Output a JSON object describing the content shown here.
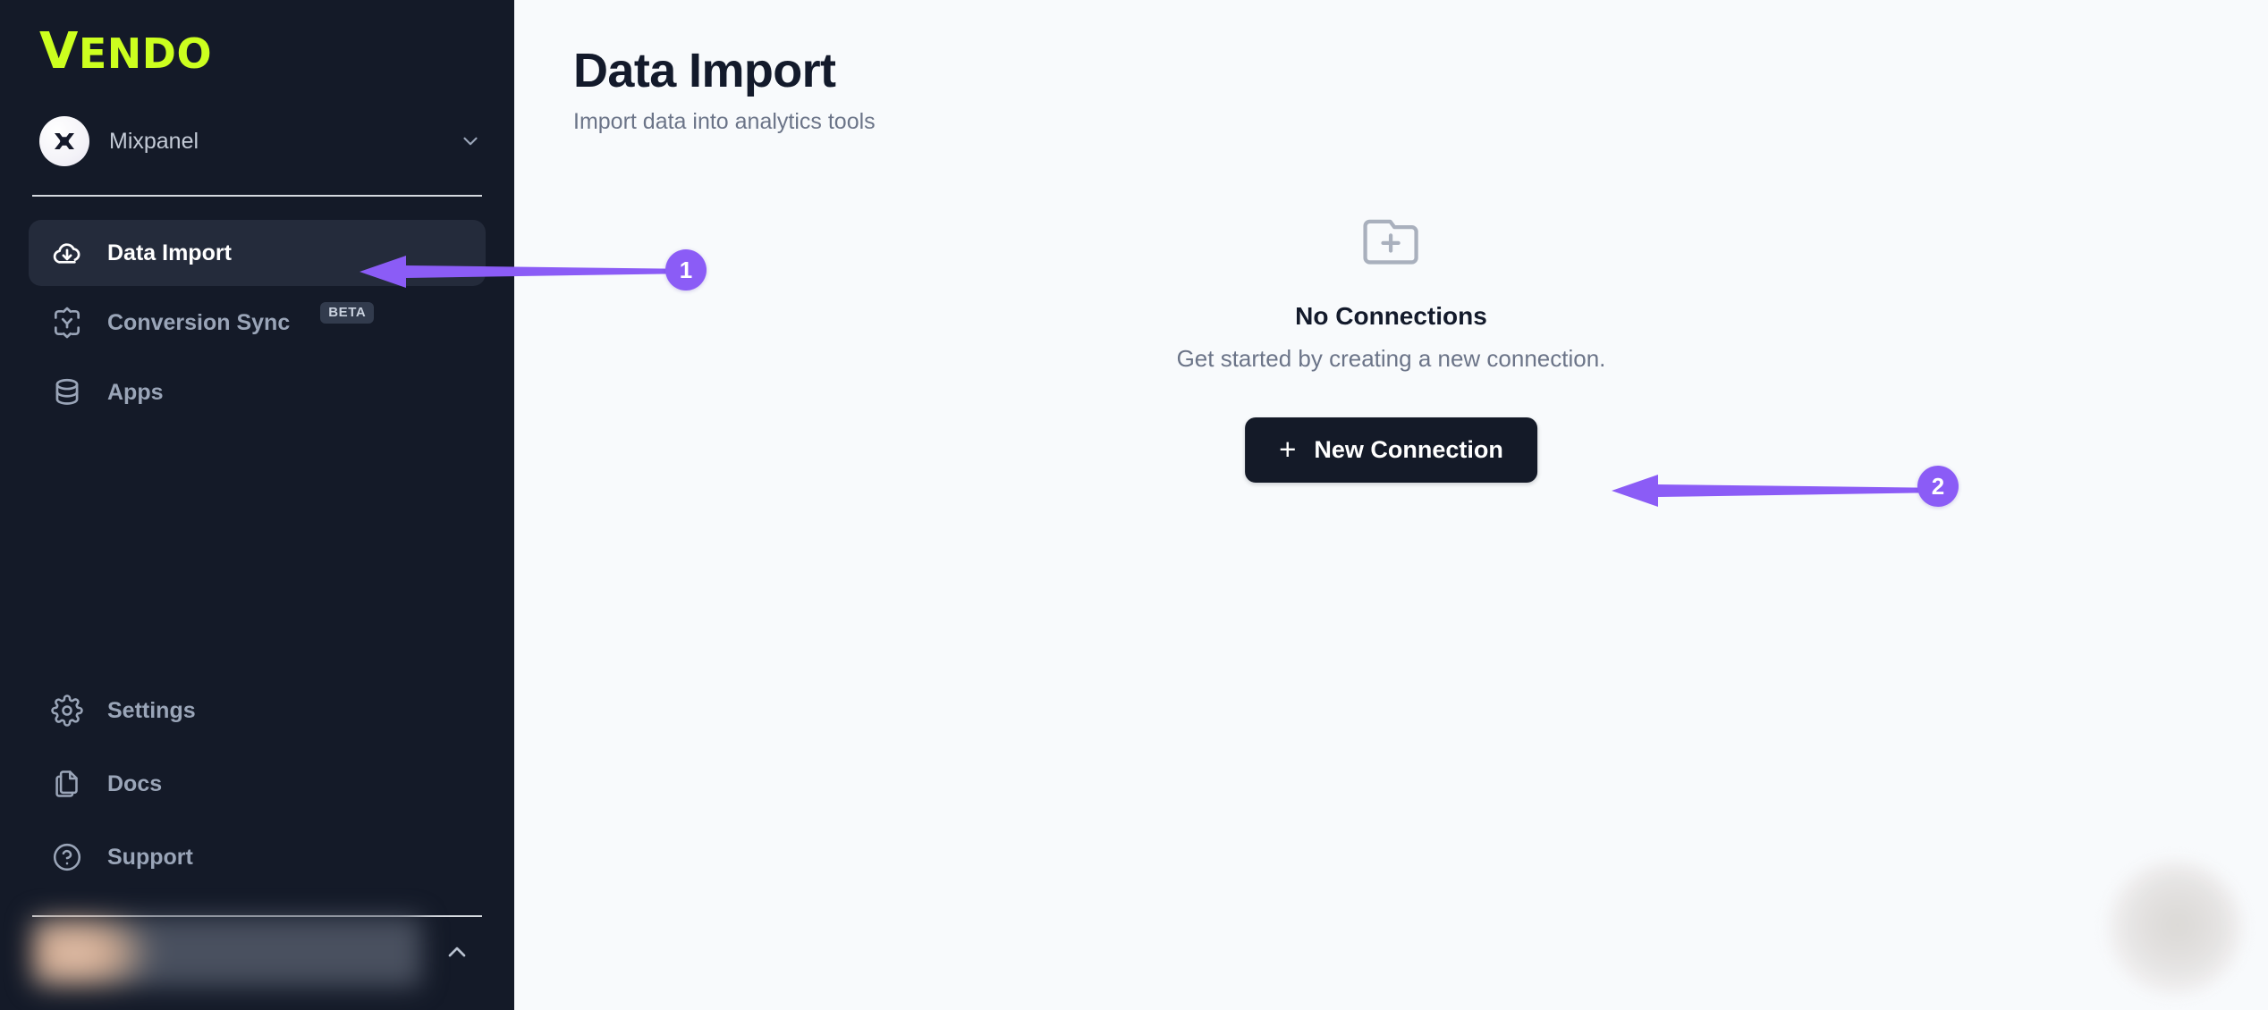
{
  "brand": {
    "logo_text": "VENDO",
    "logo_color": "#ccff1f"
  },
  "sidebar": {
    "workspace": {
      "name": "Mixpanel",
      "avatar_icon": "mixpanel-logo-icon",
      "chevron_icon": "chevron-down-icon"
    },
    "items": [
      {
        "label": "Data Import",
        "icon": "cloud-download-icon",
        "active": true,
        "badge": ""
      },
      {
        "label": "Conversion Sync",
        "icon": "conversion-sync-icon",
        "active": false,
        "badge": "BETA"
      },
      {
        "label": "Apps",
        "icon": "database-stack-icon",
        "active": false,
        "badge": ""
      }
    ],
    "bottom_items": [
      {
        "label": "Settings",
        "icon": "gear-icon"
      },
      {
        "label": "Docs",
        "icon": "documents-copy-icon"
      },
      {
        "label": "Support",
        "icon": "question-circle-icon"
      }
    ],
    "profile": {
      "label": "",
      "chevron_icon": "chevron-up-icon",
      "blurred": true
    },
    "active_item_bg": "#242b3b"
  },
  "header": {
    "title": "Data Import",
    "subtitle": "Import data into analytics tools"
  },
  "empty_state": {
    "icon": "folder-plus-icon",
    "title": "No Connections",
    "description": "Get started by creating a new connection.",
    "button_label": "New Connection",
    "button_icon": "plus-icon"
  },
  "annotations": {
    "accent_color": "#8b5cf6",
    "markers": [
      {
        "number": "1",
        "points_to": "sidebar-item-data-import"
      },
      {
        "number": "2",
        "points_to": "new-connection-button"
      }
    ]
  },
  "help_widget": {
    "icon": "help-bubble-icon"
  }
}
